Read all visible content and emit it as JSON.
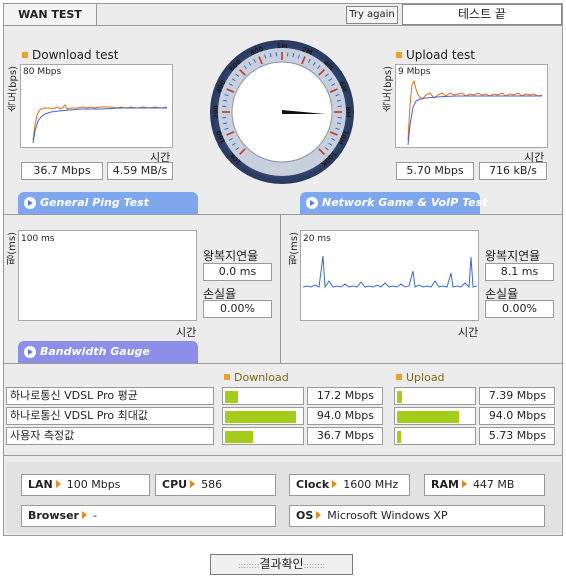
{
  "header": {
    "tab_label": "WAN TEST",
    "try_again_label": "Try again",
    "status_text": "테스트 끝"
  },
  "download_test": {
    "title": "Download test",
    "y_axis_label": "속도(bps)",
    "scale_label": "80 Mbps",
    "x_axis_label": "시간",
    "value_mbps": "36.7 Mbps",
    "value_mbs": "4.59 MB/s"
  },
  "upload_test": {
    "title": "Upload test",
    "y_axis_label": "속도(bps)",
    "scale_label": "9 Mbps",
    "x_axis_label": "시간",
    "value_mbps": "5.70 Mbps",
    "value_kbs": "716 kB/s"
  },
  "gauge": {
    "tick_labels": [
      "10K",
      "100",
      "200",
      "400",
      "600",
      "800",
      "1M",
      "2M",
      "4M",
      "6M",
      "8M",
      "10M",
      "100K"
    ],
    "needle_value": "10M"
  },
  "ping": {
    "tab_label": "General Ping Test",
    "y_axis_label": "핑(ms)",
    "scale_label": "100 ms",
    "x_axis_label": "시간",
    "latency_label": "왕복지연율",
    "latency_value": "0.0 ms",
    "loss_label": "손실율",
    "loss_value": "0.00%"
  },
  "game": {
    "tab_label": "Network Game & VoIP Test",
    "y_axis_label": "핑(ms)",
    "scale_label": "20 ms",
    "x_axis_label": "시간",
    "latency_label": "왕복지연율",
    "latency_value": "8.1 ms",
    "loss_label": "손실율",
    "loss_value": "0.00%"
  },
  "bandwidth": {
    "tab_label": "Bandwidth Gauge",
    "download_header": "Download",
    "upload_header": "Upload",
    "rows": [
      {
        "label": "하나로통신 VDSL Pro 평균",
        "download": "17.2 Mbps",
        "download_fraction": 0.172,
        "upload": "7.39 Mbps",
        "upload_fraction": 0.079
      },
      {
        "label": "하나로통신 VDSL Pro 최대값",
        "download": "94.0 Mbps",
        "download_fraction": 0.94,
        "upload": "94.0 Mbps",
        "upload_fraction": 0.94
      },
      {
        "label": "사용자 측정값",
        "download": "36.7 Mbps",
        "download_fraction": 0.367,
        "upload": "5.73 Mbps",
        "upload_fraction": 0.061
      }
    ]
  },
  "system": {
    "lan_label": "LAN",
    "lan_value": "100 Mbps",
    "cpu_label": "CPU",
    "cpu_value": "586",
    "clock_label": "Clock",
    "clock_value": "1600 MHz",
    "ram_label": "RAM",
    "ram_value": "447 MB",
    "browser_label": "Browser",
    "browser_value": "-",
    "os_label": "OS",
    "os_value": "Microsoft Windows XP"
  },
  "footer": {
    "confirm_label": "결과확인"
  },
  "colors": {
    "panel_bg": "#e8e8e8",
    "download_line": "#e86a10",
    "avg_line": "#3a67d8",
    "ping_line": "#3a67d8",
    "pill_blue": "#7fa7ee",
    "pill_purple": "#8c8ee8",
    "bar_green": "#a4cd1b",
    "accent_orange": "#f2a023"
  }
}
